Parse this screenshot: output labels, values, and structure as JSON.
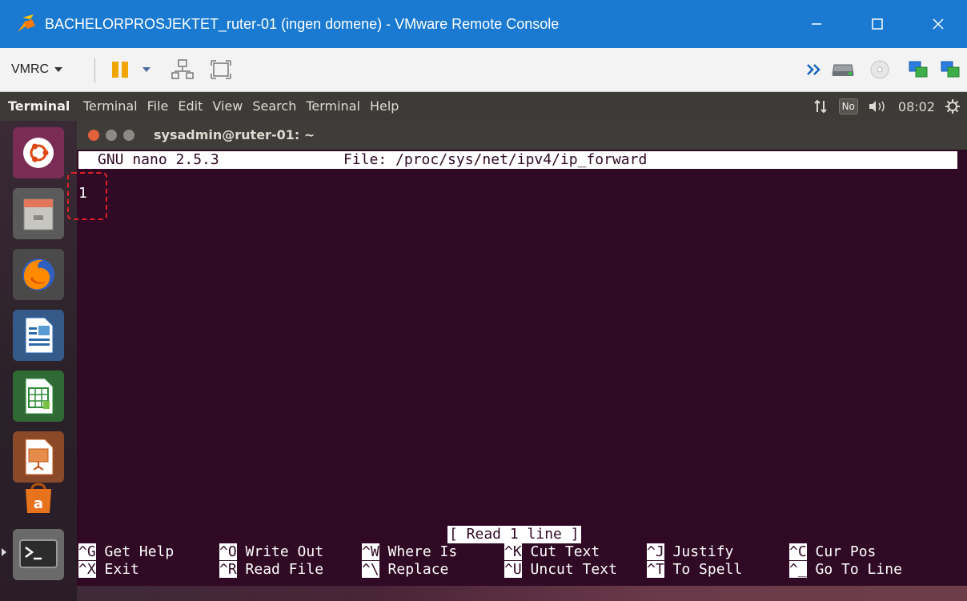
{
  "window": {
    "title": "BACHELORPROSJEKTET_ruter-01 (ingen domene) - VMware Remote Console",
    "controls": [
      "minimize-icon",
      "maximize-icon",
      "close-icon"
    ]
  },
  "toolbar": {
    "vmrc_label": "VMRC",
    "icons": [
      "pause-icon",
      "dropdown-arrow-icon",
      "network-icon",
      "fullscreen-icon",
      "more-chevrons-icon",
      "hard-disk-icon",
      "cd-drive-icon",
      "network-adapter-icon",
      "network-adapter-2-icon"
    ]
  },
  "ubuntu_panel": {
    "app_name": "Terminal",
    "menus": [
      "Terminal",
      "File",
      "Edit",
      "View",
      "Search",
      "Terminal",
      "Help"
    ],
    "keyboard_indicator": "No",
    "time": "08:02"
  },
  "launcher": {
    "items": [
      "ubuntu-dash-icon",
      "files-icon",
      "firefox-icon",
      "writer-icon",
      "calc-icon",
      "impress-icon",
      "software-center-icon",
      "terminal-icon"
    ]
  },
  "terminal": {
    "title": "sysadmin@ruter-01: ~",
    "nano_version": "GNU nano 2.5.3",
    "file_label": "File: /proc/sys/net/ipv4/ip_forward",
    "content": "1",
    "status_message": "[ Read 1 line ]",
    "shortcuts_row1": [
      {
        "key": "^G",
        "label": "Get Help"
      },
      {
        "key": "^O",
        "label": "Write Out"
      },
      {
        "key": "^W",
        "label": "Where Is"
      },
      {
        "key": "^K",
        "label": "Cut Text"
      },
      {
        "key": "^J",
        "label": "Justify"
      },
      {
        "key": "^C",
        "label": "Cur Pos"
      }
    ],
    "shortcuts_row2": [
      {
        "key": "^X",
        "label": "Exit"
      },
      {
        "key": "^R",
        "label": "Read File"
      },
      {
        "key": "^\\",
        "label": "Replace"
      },
      {
        "key": "^U",
        "label": "Uncut Text"
      },
      {
        "key": "^T",
        "label": "To Spell"
      },
      {
        "key": "^_",
        "label": "Go To Line"
      }
    ]
  },
  "colors": {
    "titlebar": "#1a7ad1",
    "terminal_bg": "#300a24",
    "annotation": "#e02020"
  }
}
